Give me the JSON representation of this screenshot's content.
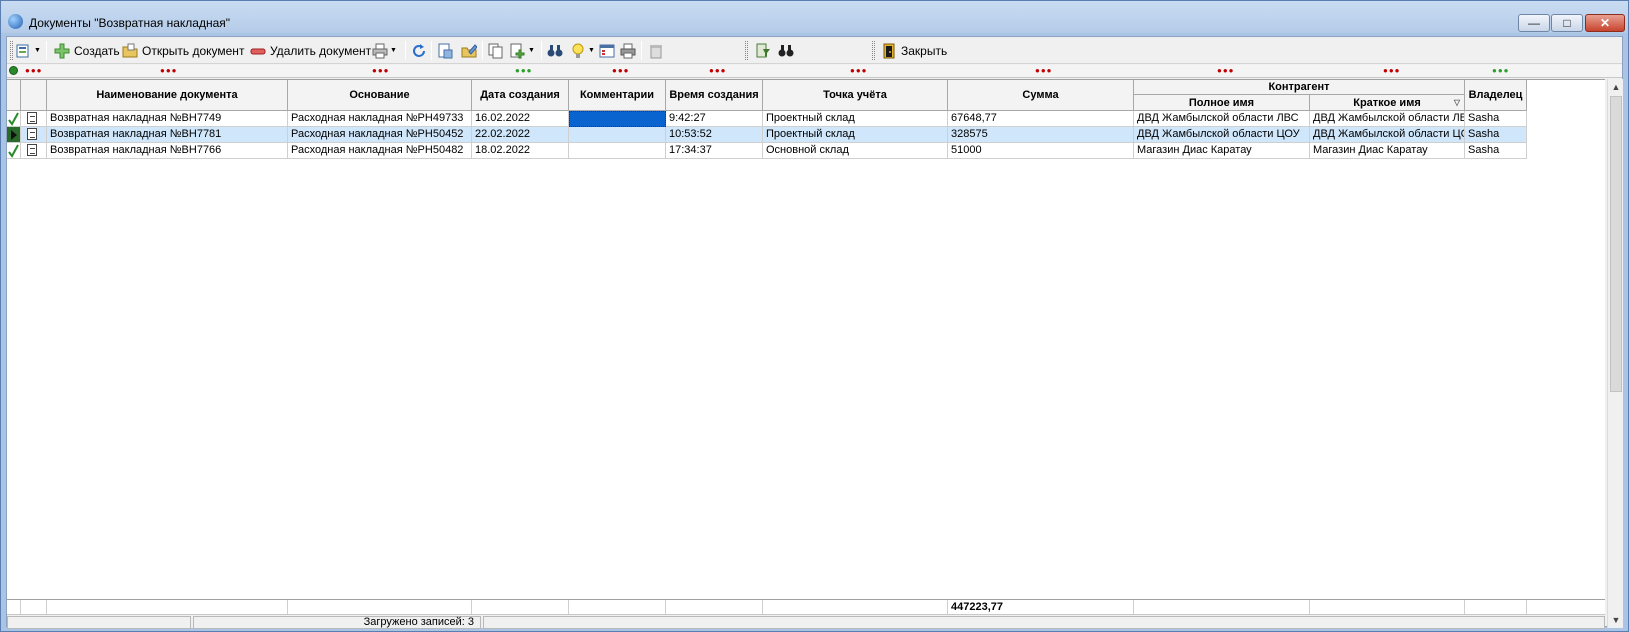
{
  "window": {
    "title": "Документы \"Возвратная накладная\"",
    "minimize_glyph": "—",
    "maximize_glyph": "□",
    "close_glyph": "✕"
  },
  "toolbar": {
    "create_label": "Создать",
    "open_label": "Открыть документ",
    "delete_label": "Удалить документ",
    "close_label": "Закрыть"
  },
  "grid": {
    "headers": {
      "doc_name": "Наименование документа",
      "basis": "Основание",
      "created_date": "Дата создания",
      "comments": "Комментарии",
      "created_time": "Время создания",
      "account_point": "Точка учёта",
      "sum": "Сумма",
      "counterparty": "Контрагент",
      "full_name": "Полное имя",
      "short_name": "Краткое имя",
      "owner": "Владелец"
    },
    "rows": [
      {
        "doc_name": "Возвратная накладная №ВН7749",
        "basis": "Расходная накладная №РН49733",
        "created_date": "16.02.2022",
        "comments": "",
        "created_time": "9:42:27",
        "account_point": "Проектный склад",
        "sum": "67648,77",
        "full_name": "ДВД Жамбылской области ЛВС",
        "short_name": "ДВД Жамбылской области ЛВ",
        "owner": "Sasha"
      },
      {
        "doc_name": "Возвратная накладная №ВН7781",
        "basis": "Расходная накладная №РН50452",
        "created_date": "22.02.2022",
        "comments": "",
        "created_time": "10:53:52",
        "account_point": "Проектный склад",
        "sum": "328575",
        "full_name": "ДВД Жамбылской области ЦОУ",
        "short_name": "ДВД Жамбылской области ЦС",
        "owner": "Sasha"
      },
      {
        "doc_name": "Возвратная накладная №ВН7766",
        "basis": "Расходная накладная №РН50482",
        "created_date": "18.02.2022",
        "comments": "",
        "created_time": "17:34:37",
        "account_point": "Основной склад",
        "sum": "51000",
        "full_name": "Магазин Диас Каратау",
        "short_name": "Магазин Диас Каратау",
        "owner": "Sasha"
      }
    ],
    "total_sum": "447223,77"
  },
  "status": {
    "loaded": "Загружено записей: 3"
  },
  "colors": {
    "selected_row": "#cfe6fb",
    "selected_cell": "#0a64d0",
    "dot_red": "#c00000",
    "dot_green": "#2aa02a"
  }
}
